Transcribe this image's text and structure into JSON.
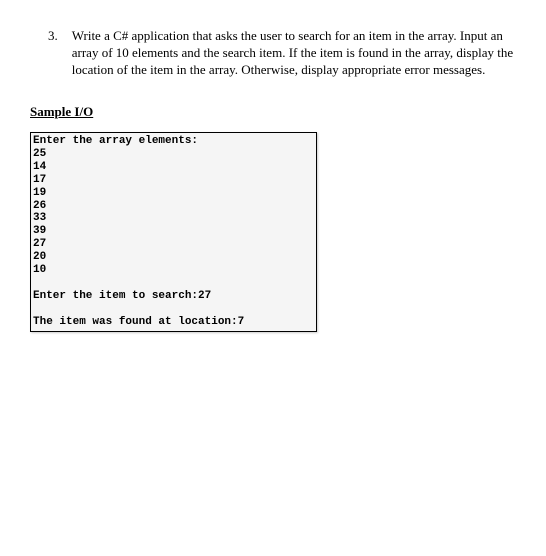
{
  "question": {
    "number": "3.",
    "text": "Write a C# application that asks the user to search for an item in the array. Input an array of 10 elements and the search item. If the item is found in the array, display the location of the item in the array. Otherwise, display appropriate error messages."
  },
  "sample_io_heading": "Sample I/O",
  "console": {
    "prompt_enter_array": "Enter the array elements:",
    "values": [
      "25",
      "14",
      "17",
      "19",
      "26",
      "33",
      "39",
      "27",
      "20",
      "10"
    ],
    "blank": "",
    "prompt_search": "Enter the item to search:27",
    "result": "The item was found at location:7"
  }
}
